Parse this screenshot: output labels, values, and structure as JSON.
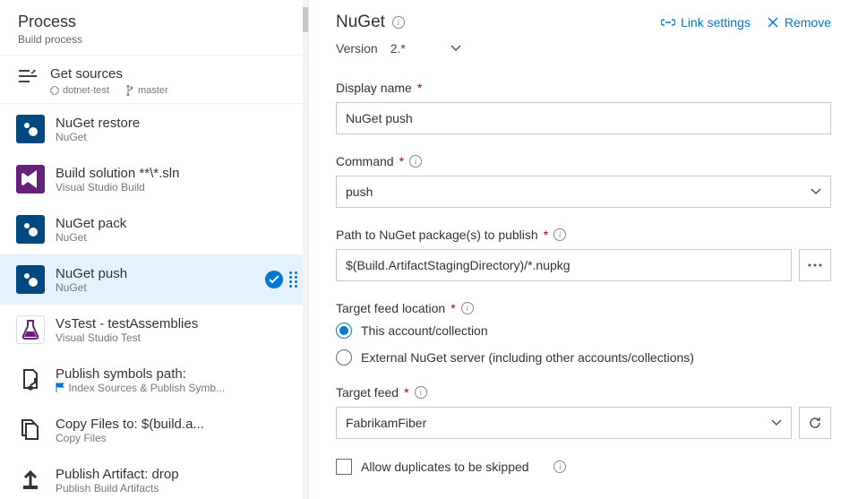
{
  "process": {
    "title": "Process",
    "subtitle": "Build process"
  },
  "get_sources": {
    "title": "Get sources",
    "repo": "dotnet-test",
    "branch": "master"
  },
  "tasks": [
    {
      "title": "NuGet restore",
      "sub": "NuGet",
      "icon": "nuget"
    },
    {
      "title": "Build solution **\\*.sln",
      "sub": "Visual Studio Build",
      "icon": "vs"
    },
    {
      "title": "NuGet pack",
      "sub": "NuGet",
      "icon": "nuget"
    },
    {
      "title": "NuGet push",
      "sub": "NuGet",
      "icon": "nuget",
      "selected": true
    },
    {
      "title": "VsTest - testAssemblies",
      "sub": "Visual Studio Test",
      "icon": "test"
    },
    {
      "title": "Publish symbols path:",
      "sub": "Index Sources & Publish Symb...",
      "icon": "symbols",
      "flag": true
    },
    {
      "title": "Copy Files to: $(build.a...",
      "sub": "Copy Files",
      "icon": "copy"
    },
    {
      "title": "Publish Artifact: drop",
      "sub": "Publish Build Artifacts",
      "icon": "artifact"
    }
  ],
  "details": {
    "title": "NuGet",
    "actions": {
      "link": "Link settings",
      "remove": "Remove"
    },
    "version": {
      "label": "Version",
      "value": "2.*"
    },
    "display_name": {
      "label": "Display name",
      "value": "NuGet push"
    },
    "command": {
      "label": "Command",
      "value": "push"
    },
    "path": {
      "label": "Path to NuGet package(s) to publish",
      "value": "$(Build.ArtifactStagingDirectory)/*.nupkg"
    },
    "target_location": {
      "label": "Target feed location",
      "options": [
        "This account/collection",
        "External NuGet server (including other accounts/collections)"
      ],
      "selected": 0
    },
    "target_feed": {
      "label": "Target feed",
      "value": "FabrikamFiber"
    },
    "allow_dup": {
      "label": "Allow duplicates to be skipped"
    }
  }
}
